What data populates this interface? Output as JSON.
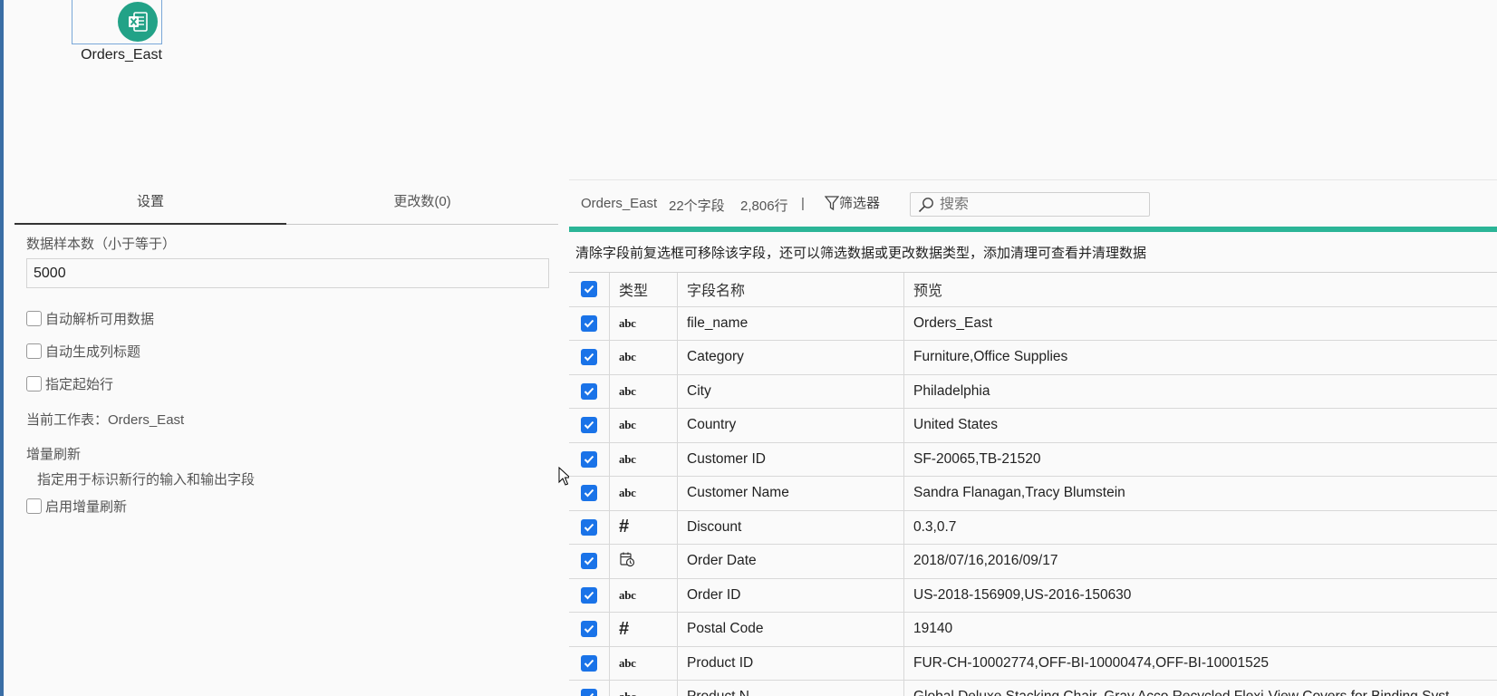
{
  "canvas": {
    "node_label": "Orders_East",
    "node_icon": "excel-file-icon"
  },
  "tabs": [
    {
      "label": "设置"
    },
    {
      "label": "更改数(0)"
    }
  ],
  "settings": {
    "sample_label": "数据样本数（小于等于）",
    "sample_value": "5000",
    "auto_parse_label": "自动解析可用数据",
    "auto_header_label": "自动生成列标题",
    "start_row_label": "指定起始行",
    "current_sheet_label": "当前工作表：Orders_East",
    "incremental_title": "增量刷新",
    "incremental_desc": "指定用于标识新行的输入和输出字段",
    "enable_incremental_label": "启用增量刷新"
  },
  "preview": {
    "source_name": "Orders_East",
    "field_count": "22个字段",
    "row_count": "2,806行",
    "separator": "|",
    "filter_label": "筛选器",
    "search_placeholder": "搜索",
    "hint": "清除字段前复选框可移除该字段，还可以筛选数据或更改数据类型，添加清理可查看并清理数据",
    "accent_color": "#2bb597",
    "checkbox_color": "#1a73e8",
    "columns": {
      "type": "类型",
      "name": "字段名称",
      "preview": "预览"
    },
    "rows": [
      {
        "type": "abc",
        "name": "file_name",
        "preview": "Orders_East"
      },
      {
        "type": "abc",
        "name": "Category",
        "preview": "Furniture,Office Supplies"
      },
      {
        "type": "abc",
        "name": "City",
        "preview": "Philadelphia"
      },
      {
        "type": "abc",
        "name": "Country",
        "preview": "United States"
      },
      {
        "type": "abc",
        "name": "Customer ID",
        "preview": "SF-20065,TB-21520"
      },
      {
        "type": "abc",
        "name": "Customer Name",
        "preview": "Sandra Flanagan,Tracy Blumstein"
      },
      {
        "type": "number",
        "name": "Discount",
        "preview": "0.3,0.7"
      },
      {
        "type": "date",
        "name": "Order Date",
        "preview": "2018/07/16,2016/09/17"
      },
      {
        "type": "abc",
        "name": "Order ID",
        "preview": "US-2018-156909,US-2016-150630"
      },
      {
        "type": "number",
        "name": "Postal Code",
        "preview": "19140"
      },
      {
        "type": "abc",
        "name": "Product ID",
        "preview": "FUR-CH-10002774,OFF-BI-10000474,OFF-BI-10001525"
      },
      {
        "type": "abc",
        "name": "Product N",
        "preview": "Global Deluxe Stacking Chair, Gray,Acco Recycled Flexi-View Covers for Binding Syst"
      }
    ]
  }
}
